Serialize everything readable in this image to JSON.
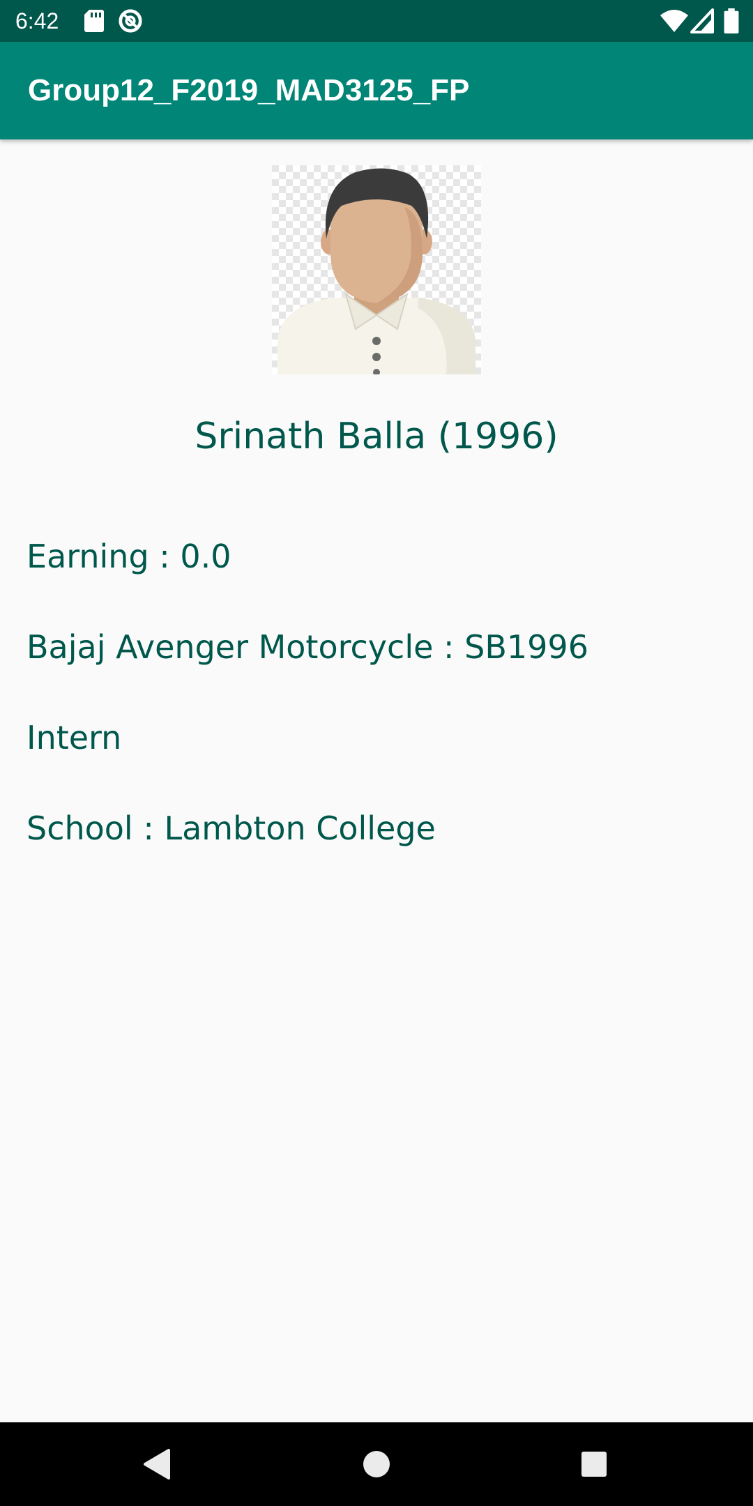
{
  "status_bar": {
    "time": "6:42",
    "icons": [
      "sd-card-icon",
      "data-saver-icon",
      "wifi-icon",
      "signal-icon",
      "battery-icon"
    ]
  },
  "app_bar": {
    "title": "Group12_F2019_MAD3125_FP",
    "color": "#008577"
  },
  "profile": {
    "avatar_icon": "person-avatar-icon",
    "name": "Srinath Balla (1996)"
  },
  "details": {
    "earning": "Earning : 0.0",
    "vehicle": "Bajaj Avenger Motorcycle : SB1996",
    "type": "Intern",
    "school": "School : Lambton College"
  },
  "nav_bar": {
    "icons": [
      "back-icon",
      "home-icon",
      "recents-icon"
    ]
  },
  "colors": {
    "primary": "#008577",
    "primary_dark": "#00574b",
    "text": "#00574b",
    "background": "#fafafa"
  }
}
